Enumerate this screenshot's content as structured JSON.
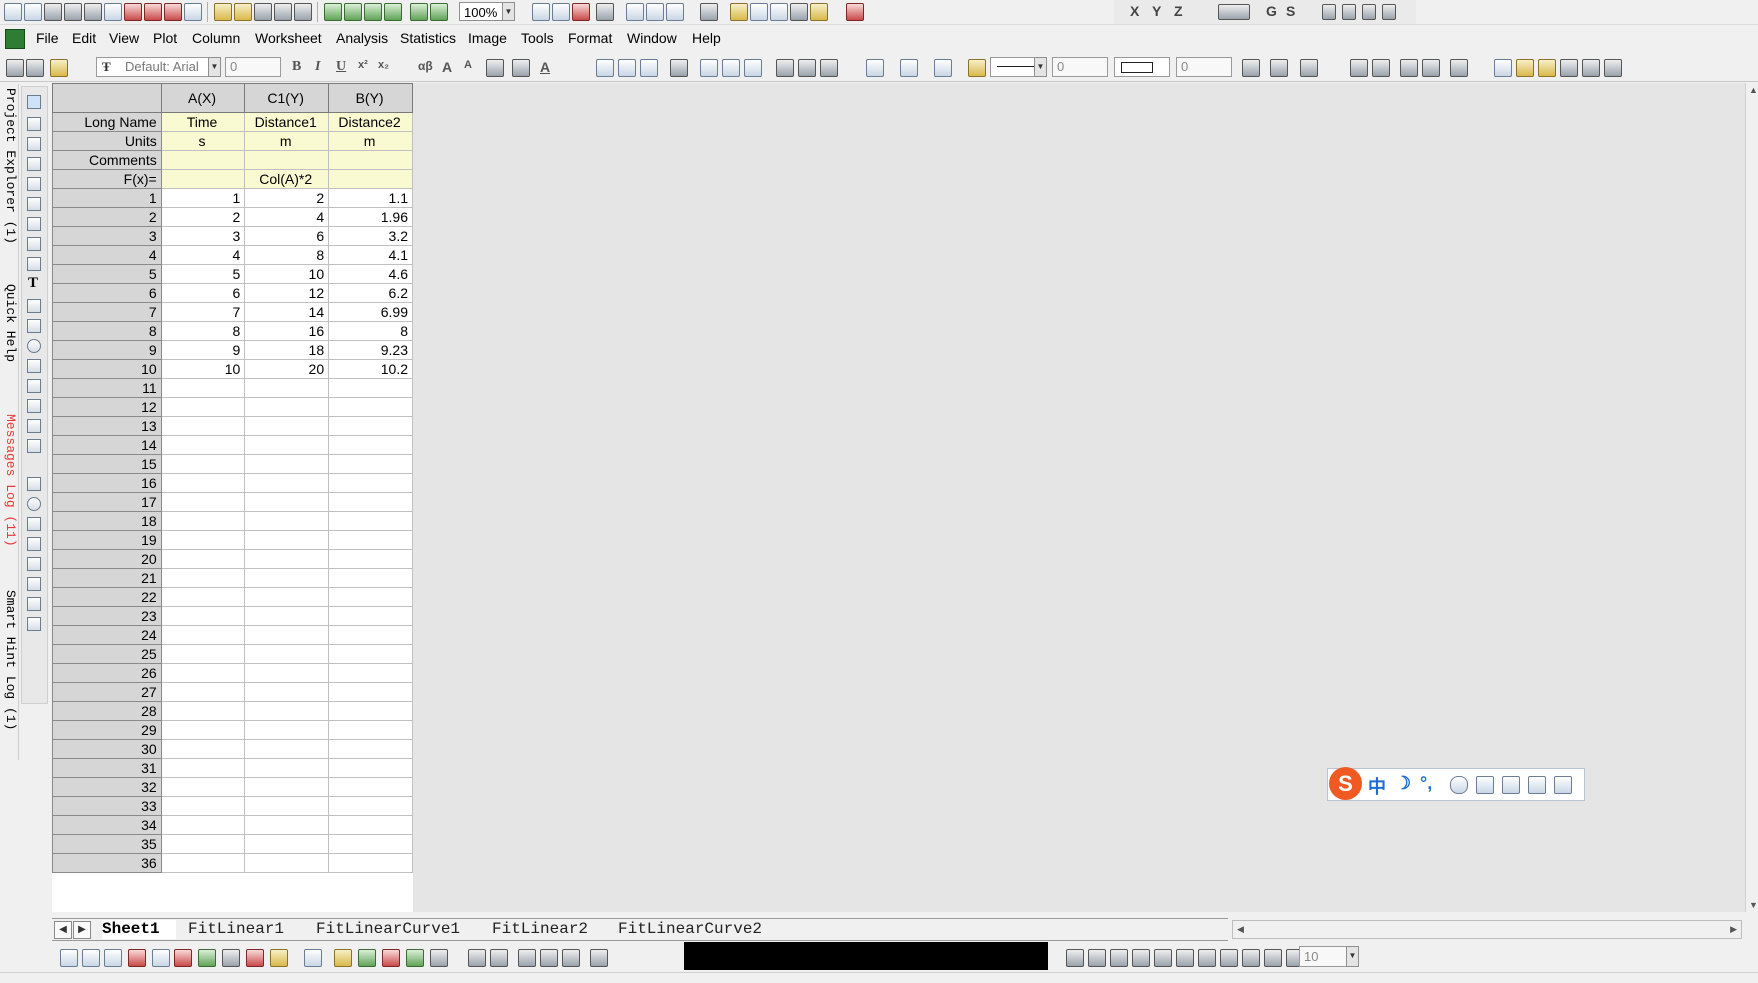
{
  "toolbar": {
    "zoom": "100%",
    "axis_labels": [
      "X",
      "Y",
      "Z",
      "G",
      "S"
    ],
    "font_name": "Default: Arial",
    "font_size": "0",
    "line_width": "0",
    "rect_width": "0",
    "bottom_size": "10"
  },
  "menu": {
    "items": [
      "File",
      "Edit",
      "View",
      "Plot",
      "Column",
      "Worksheet",
      "Analysis",
      "Statistics",
      "Image",
      "Tools",
      "Format",
      "Window",
      "Help"
    ]
  },
  "side_panel": {
    "tabs": [
      "Project Explorer (1)",
      "Quick Help",
      "Messages Log (11)",
      "Smart Hint Log (1)"
    ]
  },
  "worksheet": {
    "columns": [
      "A(X)",
      "C1(Y)",
      "B(Y)"
    ],
    "row_labels": {
      "long_name": "Long Name",
      "units": "Units",
      "comments": "Comments",
      "fx": "F(x)="
    },
    "long_names": [
      "Time",
      "Distance1",
      "Distance2"
    ],
    "units": [
      "s",
      "m",
      "m"
    ],
    "comments": [
      "",
      "",
      ""
    ],
    "formulas": [
      "",
      "Col(A)*2",
      ""
    ],
    "rows": [
      [
        "1",
        "2",
        "1.1"
      ],
      [
        "2",
        "4",
        "1.96"
      ],
      [
        "3",
        "6",
        "3.2"
      ],
      [
        "4",
        "8",
        "4.1"
      ],
      [
        "5",
        "10",
        "4.6"
      ],
      [
        "6",
        "12",
        "6.2"
      ],
      [
        "7",
        "14",
        "6.99"
      ],
      [
        "8",
        "16",
        "8"
      ],
      [
        "9",
        "18",
        "9.23"
      ],
      [
        "10",
        "20",
        "10.2"
      ]
    ],
    "row_numbers": [
      "1",
      "2",
      "3",
      "4",
      "5",
      "6",
      "7",
      "8",
      "9",
      "10",
      "11",
      "12",
      "13",
      "14",
      "15",
      "16",
      "17",
      "18",
      "19",
      "20",
      "21",
      "22",
      "23",
      "24",
      "25",
      "26",
      "27",
      "28",
      "29",
      "30",
      "31",
      "32",
      "33",
      "34",
      "35",
      "36"
    ]
  },
  "sheet_tabs": [
    "Sheet1",
    "FitLinear1",
    "FitLinearCurve1",
    "FitLinear2",
    "FitLinearCurve2"
  ],
  "active_sheet": "Sheet1",
  "ime": {
    "logo": "S",
    "mode": "中",
    "moon": "☽",
    "punct": "°,"
  }
}
